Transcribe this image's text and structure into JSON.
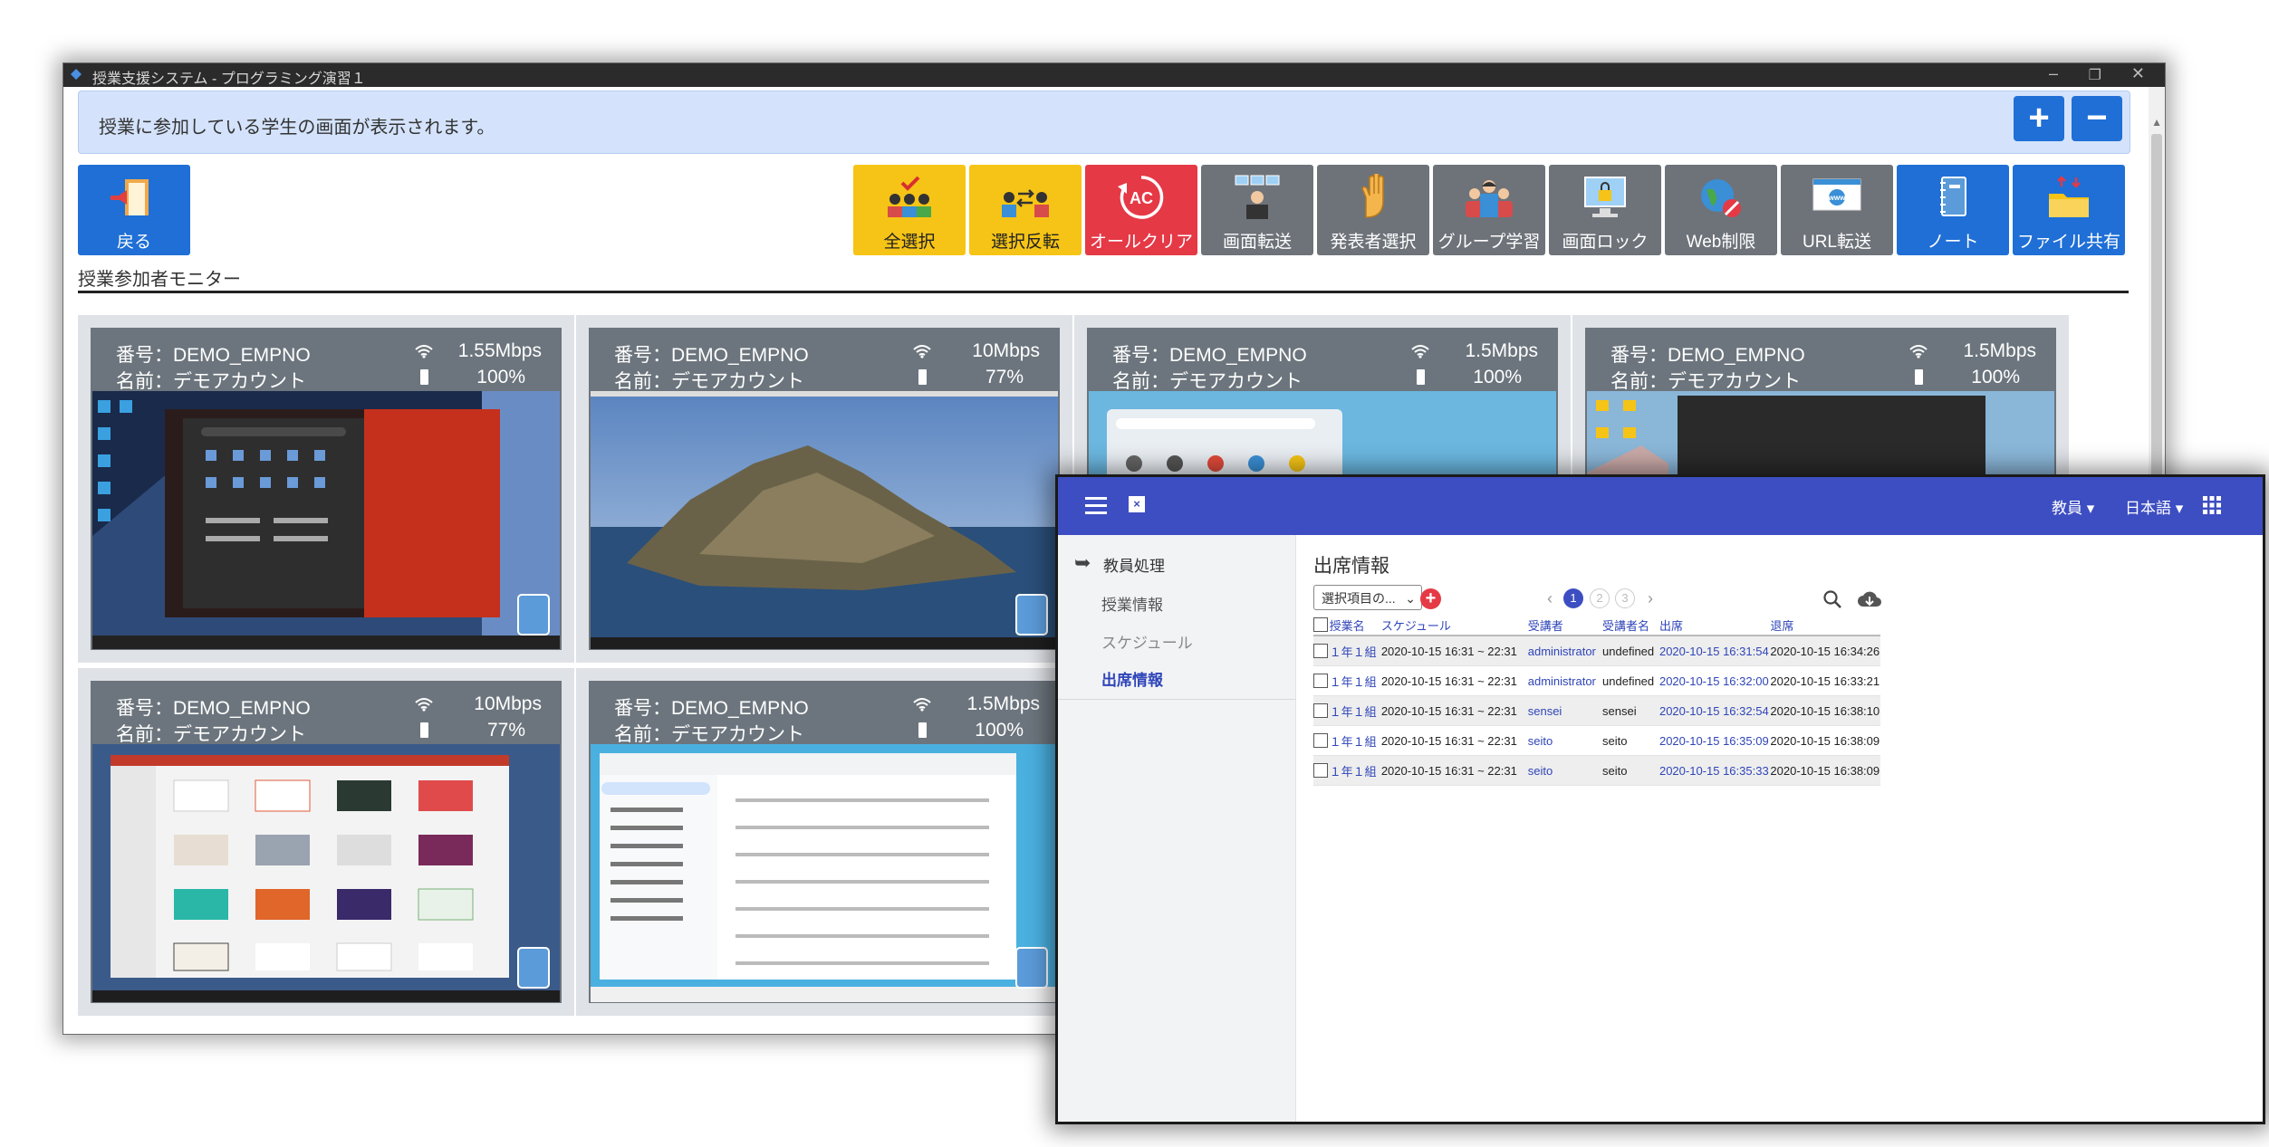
{
  "main_window": {
    "title": "授業支援システム - プログラミング演習１",
    "banner_text": "授業に参加している学生の画面が表示されます。",
    "zoom_in": "+",
    "zoom_out": "−",
    "back_label": "戻る",
    "section_title": "授業参加者モニター",
    "tools": [
      {
        "label": "全選択",
        "icon": "select-all-icon",
        "color": "#f6c416"
      },
      {
        "label": "選択反転",
        "icon": "invert-selection-icon",
        "color": "#f6c416"
      },
      {
        "label": "オールクリア",
        "icon": "all-clear-icon",
        "color": "#e53946"
      },
      {
        "label": "画面転送",
        "icon": "screen-transfer-icon",
        "color": "#6e737a"
      },
      {
        "label": "発表者選択",
        "icon": "raise-hand-icon",
        "color": "#6e737a"
      },
      {
        "label": "グループ学習",
        "icon": "group-study-icon",
        "color": "#6e737a"
      },
      {
        "label": "画面ロック",
        "icon": "screen-lock-icon",
        "color": "#6e737a"
      },
      {
        "label": "Web制限",
        "icon": "web-restrict-icon",
        "color": "#6e737a"
      },
      {
        "label": "URL転送",
        "icon": "url-transfer-icon",
        "color": "#6e737a"
      },
      {
        "label": "ノート",
        "icon": "notebook-icon",
        "color": "#1f6fd6"
      },
      {
        "label": "ファイル共有",
        "icon": "file-share-icon",
        "color": "#1f6fd6"
      }
    ],
    "tiles": [
      {
        "number": "番号：DEMO_EMPNO",
        "name": "名前：デモアカウント",
        "speed": "1.55Mbps",
        "battery": "100%",
        "screen": "windows-start"
      },
      {
        "number": "番号：DEMO_EMPNO",
        "name": "名前：デモアカウント",
        "speed": "10Mbps",
        "battery": "77%",
        "screen": "mac-island"
      },
      {
        "number": "番号：DEMO_EMPNO",
        "name": "名前：デモアカウント",
        "speed": "1.5Mbps",
        "battery": "100%",
        "screen": "chrome-launcher"
      },
      {
        "number": "番号：DEMO_EMPNO",
        "name": "名前：デモアカウント",
        "speed": "1.5Mbps",
        "battery": "100%",
        "screen": "mac-desktop"
      },
      {
        "number": "番号：DEMO_EMPNO",
        "name": "名前：デモアカウント",
        "speed": "10Mbps",
        "battery": "77%",
        "screen": "mac-powerpoint"
      },
      {
        "number": "番号：DEMO_EMPNO",
        "name": "名前：デモアカウント",
        "speed": "1.5Mbps",
        "battery": "100%",
        "screen": "chromeos-settings"
      }
    ]
  },
  "attendance": {
    "nav": {
      "role": "教員 ▾",
      "lang": "日本語 ▾"
    },
    "side": {
      "head": "教員処理",
      "items": [
        "授業情報",
        "スケジュール",
        "出席情報"
      ]
    },
    "title": "出席情報",
    "select_placeholder": "選択項目の...",
    "pages": [
      "1",
      "2",
      "3"
    ],
    "columns": [
      "授業名",
      "スケジュール",
      "受講者",
      "受講者名",
      "出席",
      "退席"
    ],
    "rows": [
      {
        "class": "１年１組",
        "schedule": "2020-10-15 16:31 ~ 22:31",
        "user": "administrator",
        "user_name": "undefined",
        "in": "2020-10-15 16:31:54",
        "out": "2020-10-15 16:34:26"
      },
      {
        "class": "１年１組",
        "schedule": "2020-10-15 16:31 ~ 22:31",
        "user": "administrator",
        "user_name": "undefined",
        "in": "2020-10-15 16:32:00",
        "out": "2020-10-15 16:33:21"
      },
      {
        "class": "１年１組",
        "schedule": "2020-10-15 16:31 ~ 22:31",
        "user": "sensei",
        "user_name": "sensei",
        "in": "2020-10-15 16:32:54",
        "out": "2020-10-15 16:38:10"
      },
      {
        "class": "１年１組",
        "schedule": "2020-10-15 16:31 ~ 22:31",
        "user": "seito",
        "user_name": "seito",
        "in": "2020-10-15 16:35:09",
        "out": "2020-10-15 16:38:09"
      },
      {
        "class": "１年１組",
        "schedule": "2020-10-15 16:31 ~ 22:31",
        "user": "seito",
        "user_name": "seito",
        "in": "2020-10-15 16:35:33",
        "out": "2020-10-15 16:38:09"
      }
    ]
  }
}
